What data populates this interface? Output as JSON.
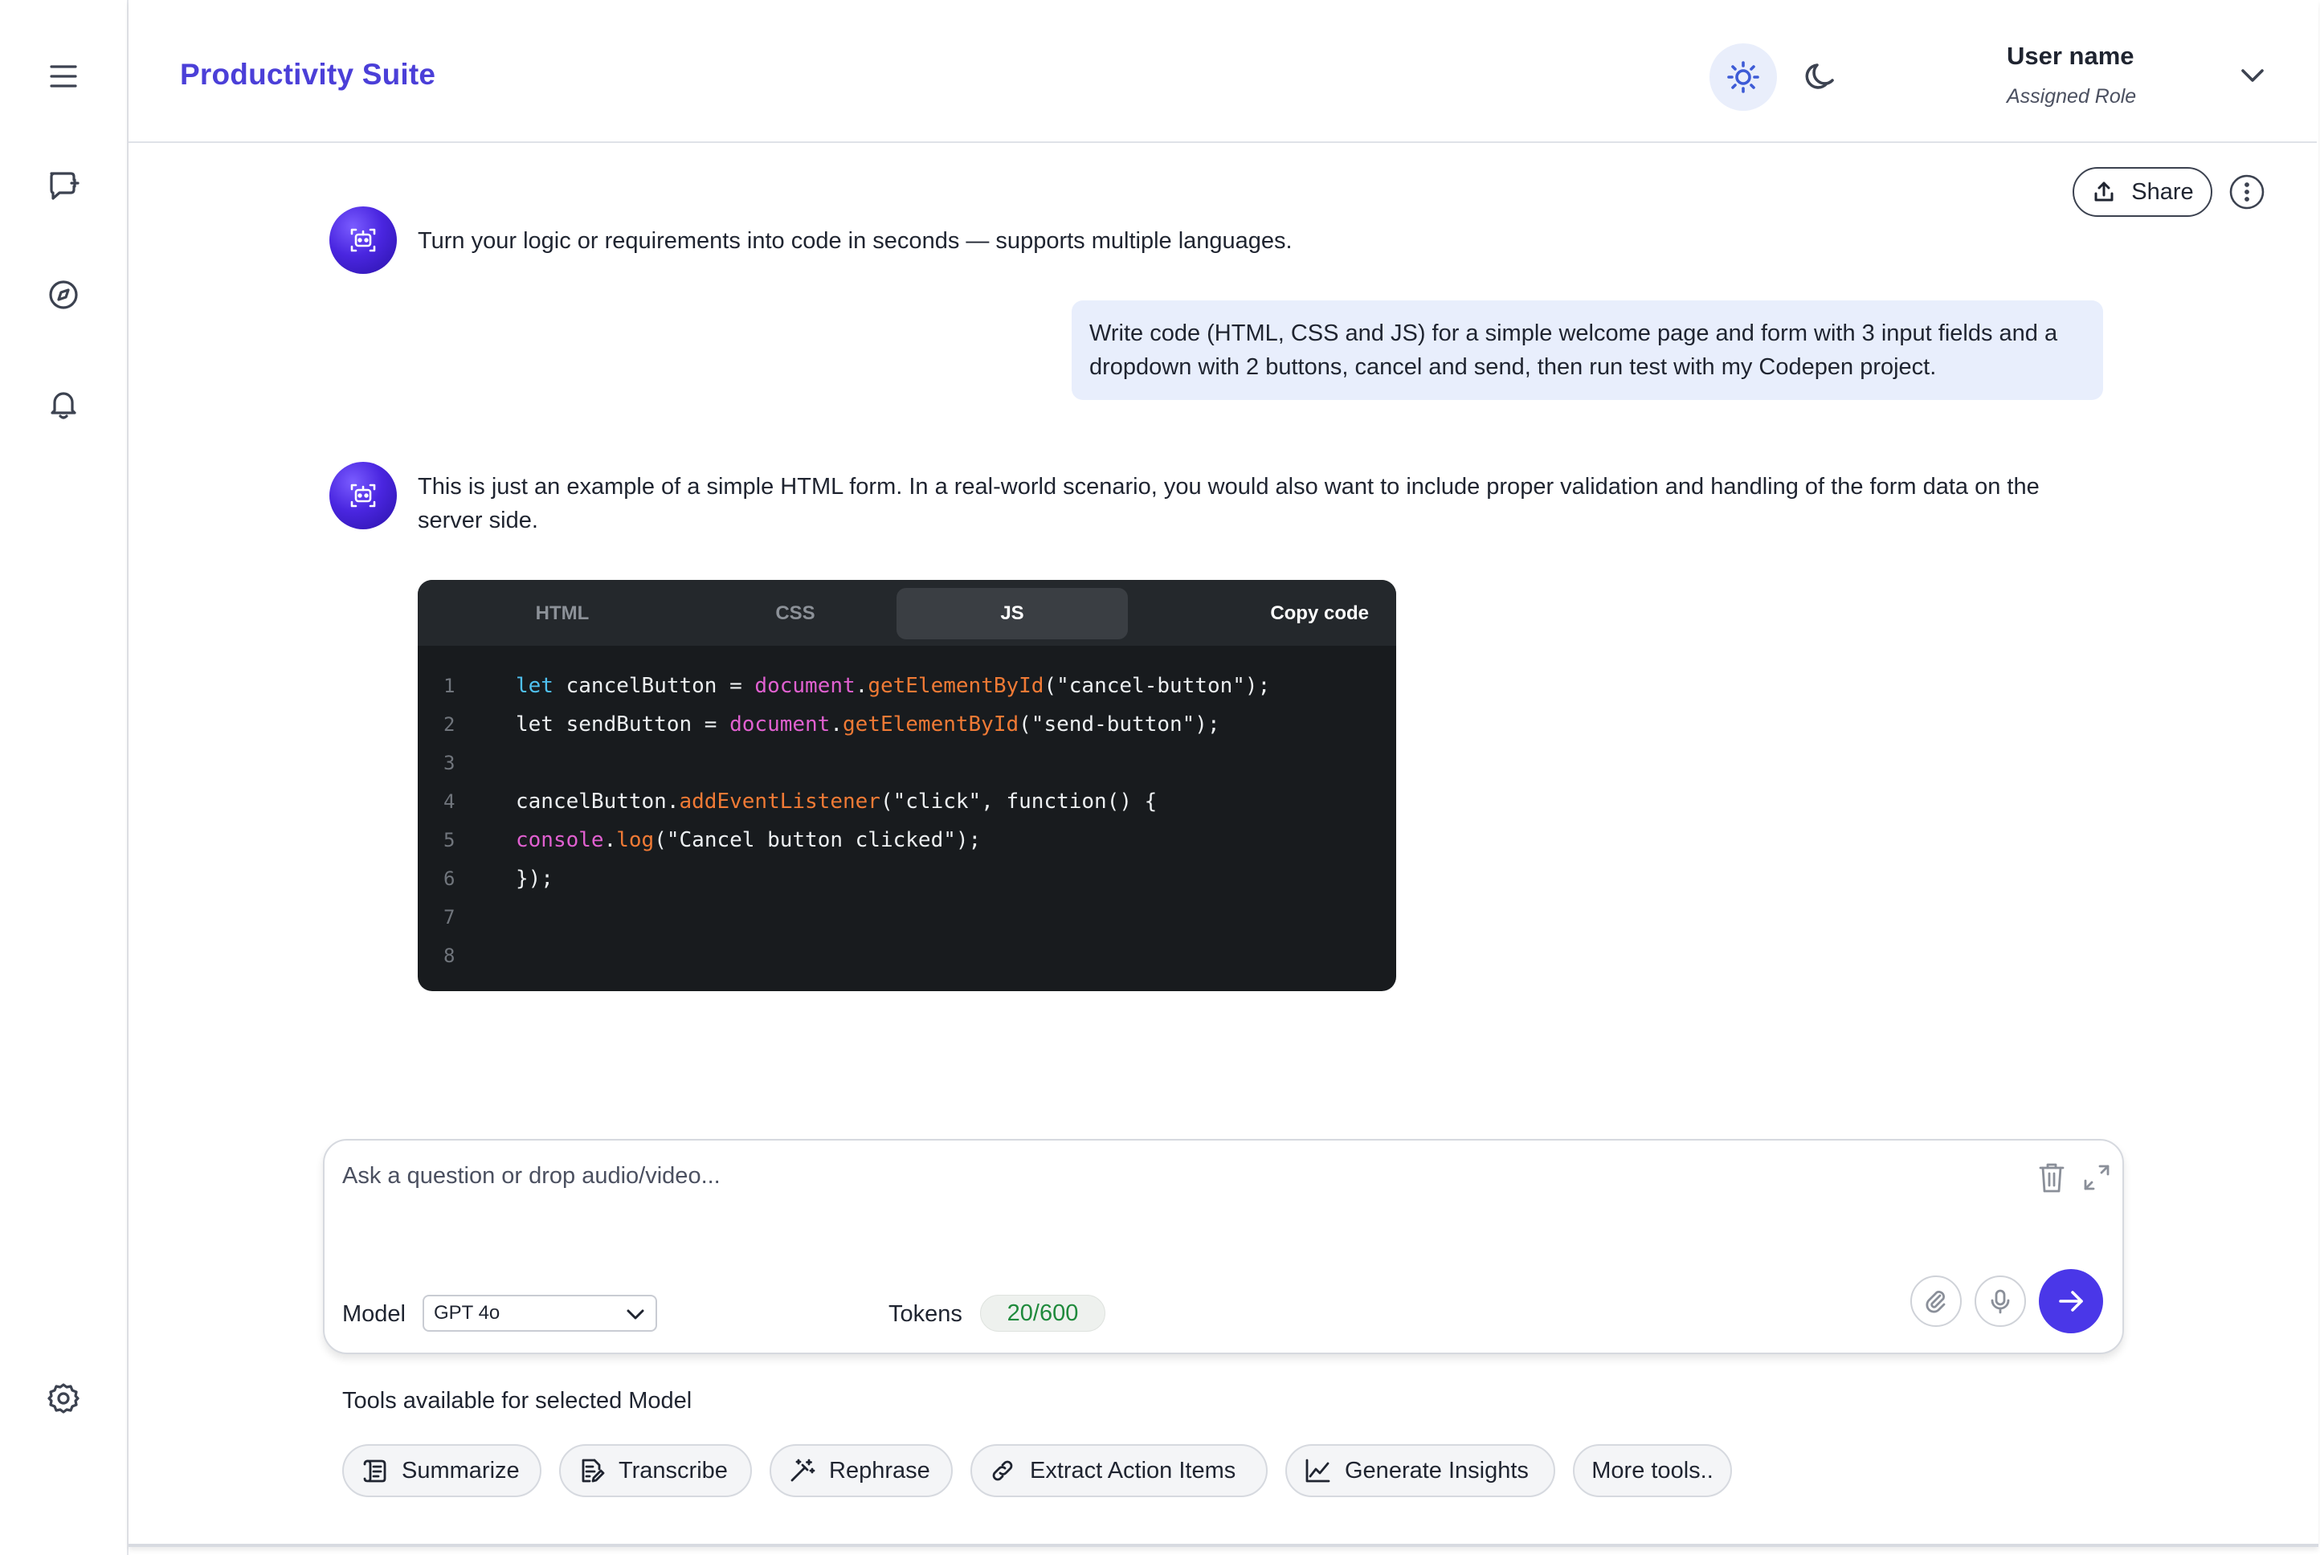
{
  "app": {
    "title": "Productivity Suite"
  },
  "user": {
    "name": "User name",
    "role": "Assigned Role"
  },
  "header": {
    "share_label": "Share"
  },
  "messages": [
    {
      "from": "assistant",
      "text": "Turn your logic or requirements into code in seconds — supports multiple languages."
    },
    {
      "from": "user",
      "text": "Write code (HTML, CSS and JS) for a simple welcome page and form with 3 input fields and a dropdown with 2 buttons, cancel and send, then run test with my Codepen project."
    },
    {
      "from": "assistant",
      "text": "This is just an example of a simple HTML form. In a real-world scenario, you would also want to include proper validation and handling of the form data on the server side."
    }
  ],
  "code_block": {
    "tabs": [
      "HTML",
      "CSS",
      "JS"
    ],
    "active_tab": "JS",
    "copy_label": "Copy code",
    "lines": [
      {
        "n": "1",
        "tokens": [
          [
            "kw",
            "let"
          ],
          [
            "plain",
            " cancelButton = "
          ],
          [
            "obj",
            "document"
          ],
          [
            "plain",
            "."
          ],
          [
            "fn",
            "getElementById"
          ],
          [
            "plain",
            "(\"cancel-button\");"
          ]
        ]
      },
      {
        "n": "2",
        "tokens": [
          [
            "plain",
            "let sendButton = "
          ],
          [
            "obj",
            "document"
          ],
          [
            "plain",
            "."
          ],
          [
            "fn",
            "getElementById"
          ],
          [
            "plain",
            "(\"send-button\");"
          ]
        ]
      },
      {
        "n": "3",
        "tokens": []
      },
      {
        "n": "4",
        "tokens": [
          [
            "plain",
            "cancelButton."
          ],
          [
            "fn",
            "addEventListener"
          ],
          [
            "plain",
            "(\"click\", function() {"
          ]
        ]
      },
      {
        "n": "5",
        "tokens": [
          [
            "obj",
            "console"
          ],
          [
            "plain",
            "."
          ],
          [
            "fn",
            "log"
          ],
          [
            "plain",
            "(\"Cancel button clicked\");"
          ]
        ]
      },
      {
        "n": "6",
        "tokens": [
          [
            "plain",
            "});"
          ]
        ]
      },
      {
        "n": "7",
        "tokens": []
      },
      {
        "n": "8",
        "tokens": []
      }
    ]
  },
  "composer": {
    "placeholder": "Ask a question or drop audio/video...",
    "model_label": "Model",
    "model_value": "GPT 4o",
    "tokens_label": "Tokens",
    "tokens_value": "20/600"
  },
  "tools": {
    "label": "Tools available for selected Model",
    "items": [
      {
        "label": "Summarize",
        "icon": "summarize-icon"
      },
      {
        "label": "Transcribe",
        "icon": "transcribe-icon"
      },
      {
        "label": "Rephrase",
        "icon": "magic-wand-icon"
      },
      {
        "label": "Extract Action Items",
        "icon": "link-icon"
      },
      {
        "label": "Generate Insights",
        "icon": "chart-line-icon"
      },
      {
        "label": "More tools..",
        "icon": ""
      }
    ]
  },
  "colors": {
    "accent": "#4a37e8",
    "brand": "#4b3fd8",
    "user_bubble": "#e8eefc",
    "code_bg": "#181b1e",
    "tokens_green": "#1f8a3c"
  }
}
